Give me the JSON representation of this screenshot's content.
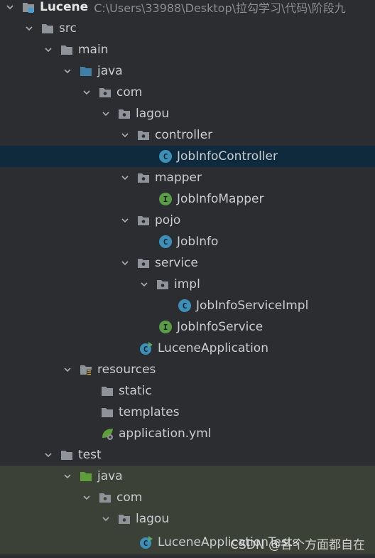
{
  "project": {
    "name": "Lucene",
    "path": "C:\\Users\\33988\\Desktop\\拉勾学习\\代码\\阶段九"
  },
  "tree": {
    "src": "src",
    "main": "main",
    "java_main": "java",
    "com_main": "com",
    "lagou_main": "lagou",
    "controller": "controller",
    "job_info_controller": "JobInfoController",
    "mapper": "mapper",
    "job_info_mapper": "JobInfoMapper",
    "pojo": "pojo",
    "job_info": "JobInfo",
    "service": "service",
    "impl": "impl",
    "job_info_service_impl": "JobInfoServiceImpl",
    "job_info_service": "JobInfoService",
    "lucene_application": "LuceneApplication",
    "resources": "resources",
    "static": "static",
    "templates": "templates",
    "application_yml": "application.yml",
    "test": "test",
    "java_test": "java",
    "com_test": "com",
    "lagou_test": "lagou",
    "lucene_application_tests": "LuceneApplicationTests"
  },
  "watermark": "CSDN @各个方面都自在",
  "colors": {
    "background": "#2b2d30",
    "selected_row": "#0e2a3c",
    "test_rows": "#3b4137",
    "class_icon": "#3d8fb8",
    "interface_icon": "#5b9a46",
    "folder": "#8e9399",
    "source_folder": "#3f7fa8",
    "test_source_folder": "#5e9f3a",
    "text": "#c9ccd1"
  },
  "icons": {
    "expanded": "chevron-down-icon",
    "folder": "folder-icon",
    "package": "package-icon",
    "class": "class-icon",
    "interface": "interface-icon",
    "spring_boot_class": "spring-boot-class-icon",
    "resources": "resources-folder-icon",
    "yml": "yml-file-icon"
  }
}
